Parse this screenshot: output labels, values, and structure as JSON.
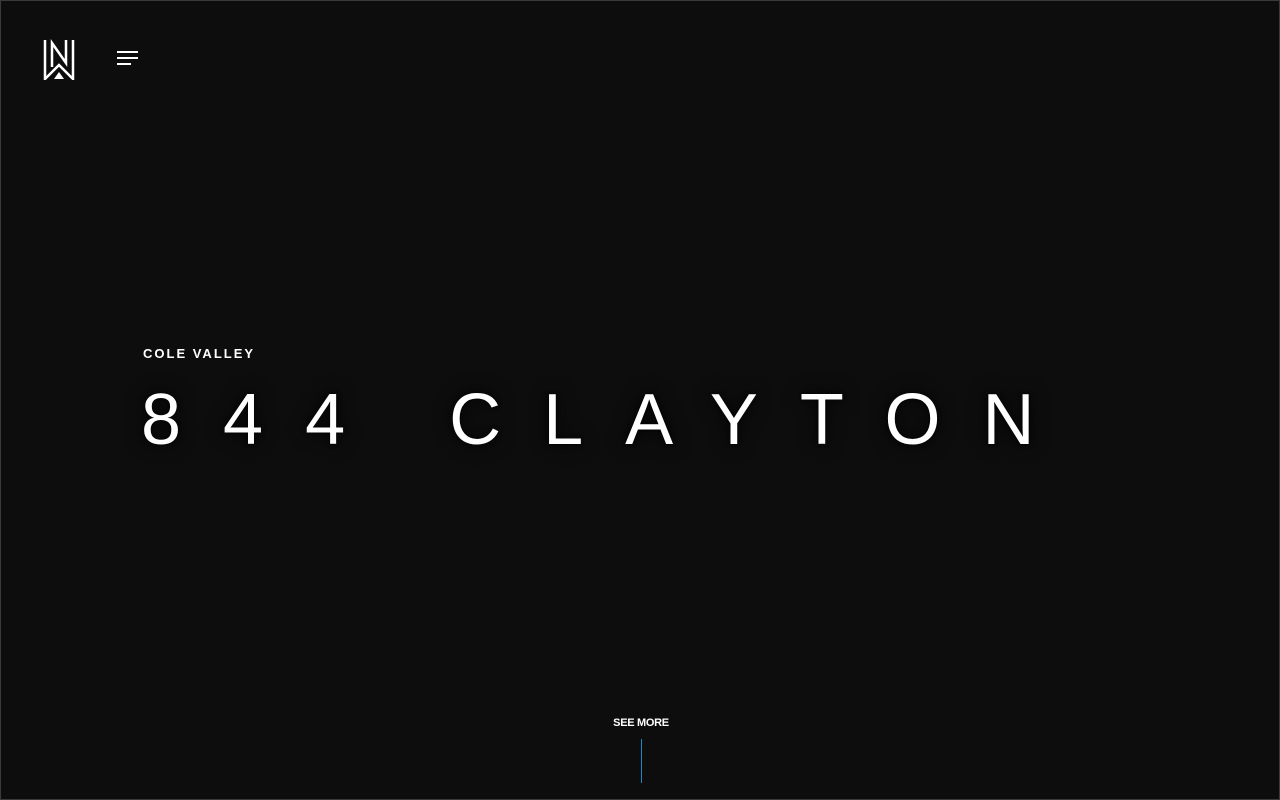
{
  "header": {
    "logo_icon": "nw-monogram-logo",
    "menu_icon": "hamburger-menu-icon"
  },
  "hero": {
    "neighborhood": "COLE VALLEY",
    "title": "844 CLAYTON"
  },
  "scroll_prompt": {
    "label": "SEE MORE",
    "line_color": "#1e86c7"
  },
  "colors": {
    "background": "#0d0d0e",
    "text": "#ffffff",
    "accent": "#1e86c7"
  }
}
